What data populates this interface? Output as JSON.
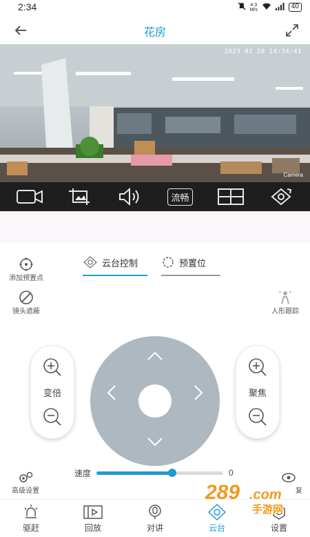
{
  "status": {
    "time": "2:34",
    "network_speed": "4.3",
    "network_unit": "M/s",
    "battery": "40"
  },
  "header": {
    "title": "花房"
  },
  "video": {
    "timestamp": "2023 02 20   14:34:41",
    "camera_label": "Camera"
  },
  "toolbar": {
    "quality_label": "流畅"
  },
  "controls": {
    "add_preset_label": "添加预置点",
    "lens_cover_label": "镜头遮蔽",
    "human_tracking_label": "人形跟踪",
    "advanced_label": "高级设置",
    "right_bottom_label": "复"
  },
  "tabs": [
    {
      "label": "云台控制",
      "active": true
    },
    {
      "label": "预置位",
      "active": false
    }
  ],
  "zoom": {
    "label": "变倍"
  },
  "focus": {
    "label": "聚焦"
  },
  "speed": {
    "label": "速度",
    "value": "0",
    "level": 0.6
  },
  "nav": [
    {
      "label": "驱赶",
      "icon": "alarm-light-icon"
    },
    {
      "label": "回放",
      "icon": "playback-icon"
    },
    {
      "label": "对讲",
      "icon": "intercom-icon"
    },
    {
      "label": "云台",
      "icon": "ptz-icon",
      "active": true
    },
    {
      "label": "设置",
      "icon": "settings-icon"
    }
  ],
  "watermark": {
    "text": "289.com",
    "subtext": "手游网"
  },
  "colors": {
    "accent": "#1f9bd1",
    "toolbar_bg": "#1e1e1e",
    "joystick": "#aeb8c0",
    "watermark": "#f29a1f"
  }
}
